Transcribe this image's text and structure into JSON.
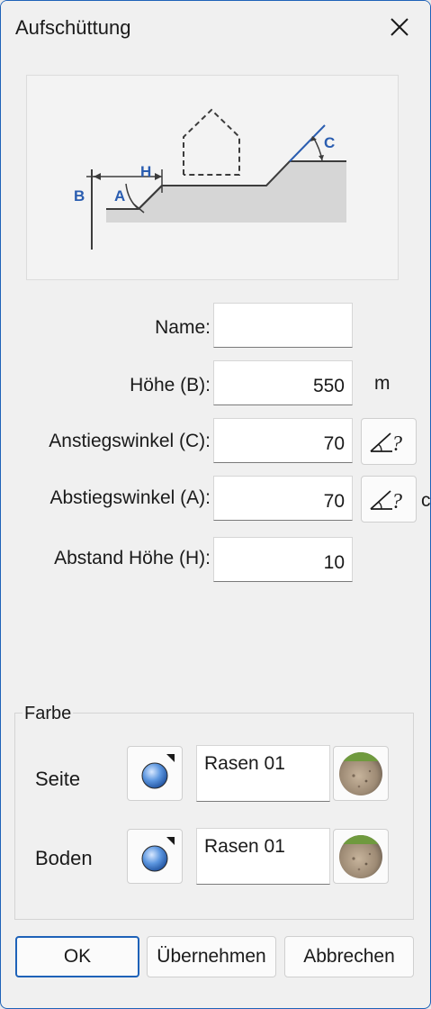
{
  "window": {
    "title": "Aufschüttung"
  },
  "diagram": {
    "labels": {
      "b": "B",
      "a": "A",
      "h": "H",
      "c": "C"
    }
  },
  "form": {
    "name_label": "Name:",
    "name_value": "",
    "height_label": "Höhe (B):",
    "height_value": "550",
    "height_unit": "m",
    "rise_label": "Anstiegswinkel (C):",
    "rise_value": "70",
    "fall_label": "Abstiegswinkel (A):",
    "fall_value": "70",
    "fall_unit_partial": "c",
    "distance_label": "Abstand Höhe (H):",
    "distance_value": "10"
  },
  "color_group": {
    "title": "Farbe",
    "rows": [
      {
        "label": "Seite",
        "material": "Rasen 01"
      },
      {
        "label": "Boden",
        "material": "Rasen 01"
      }
    ]
  },
  "buttons": {
    "ok": "OK",
    "apply": "Übernehmen",
    "cancel": "Abbrechen"
  },
  "icons": {
    "close": "close-icon",
    "angle_picker": "angle-picker-icon",
    "eyedropper": "pick-material-icon",
    "material_preview": "terrain-material-thumbnail"
  },
  "colors": {
    "accent": "#1e62b8",
    "diagram_label": "#2a5db0",
    "ground": "#d6d6d6"
  }
}
